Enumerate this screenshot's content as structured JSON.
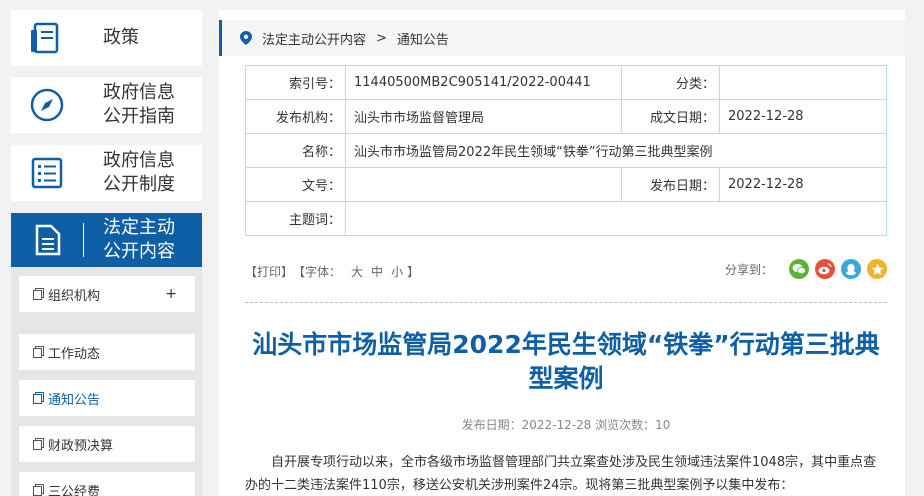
{
  "sidebar": {
    "items": [
      {
        "label": "政策",
        "icon": "book-icon"
      },
      {
        "label": "政府信息\n公开指南",
        "icon": "compass-icon"
      },
      {
        "label": "政府信息\n公开制度",
        "icon": "list-icon"
      },
      {
        "label": "法定主动\n公开内容",
        "icon": "document-icon"
      }
    ],
    "subitems": [
      {
        "label": "组织机构",
        "expand": "+"
      },
      {
        "label": "工作动态"
      },
      {
        "label": "通知公告"
      },
      {
        "label": "财政预决算"
      },
      {
        "label": "三公经费"
      }
    ]
  },
  "breadcrumb": {
    "parent": "法定主动公开内容",
    "separator": ">",
    "current": "通知公告"
  },
  "meta": {
    "index_label": "索引号：",
    "index_value": "11440500MB2C905141/2022-00441",
    "category_label": "分类：",
    "category_value": "",
    "org_label": "发布机构：",
    "org_value": "汕头市市场监督管理局",
    "created_label": "成文日期：",
    "created_value": "2022-12-28",
    "name_label": "名称：",
    "name_value": "汕头市市场监管局2022年民生领域“铁拳”行动第三批典型案例",
    "docno_label": "文号：",
    "docno_value": "",
    "published_label": "发布日期：",
    "published_value": "2022-12-28",
    "subject_label": "主题词：",
    "subject_value": ""
  },
  "tools": {
    "print": "【打印】",
    "font_prefix": "【字体：",
    "font_large": "大",
    "font_medium": "中",
    "font_small": "小",
    "font_suffix": "】",
    "share_label": "分享到："
  },
  "article": {
    "title": "汕头市市场监管局2022年民生领域“铁拳”行动第三批典型案例",
    "pubinfo": "发布日期：2022-12-28  浏览次数：10",
    "para": "自开展专项行动以来，全市各级市场监督管理部门共立案查处涉及民生领域违法案件1048宗，其中重点查办的十二类违法案件110宗，移送公安机关涉刑案件24宗。现将第三批典型案例予以集中发布："
  },
  "colors": {
    "accent": "#0f5fa6",
    "wechat": "#5cb531",
    "weibo": "#e6503c",
    "qq": "#3fa6dc",
    "qzone": "#f0b42b"
  }
}
